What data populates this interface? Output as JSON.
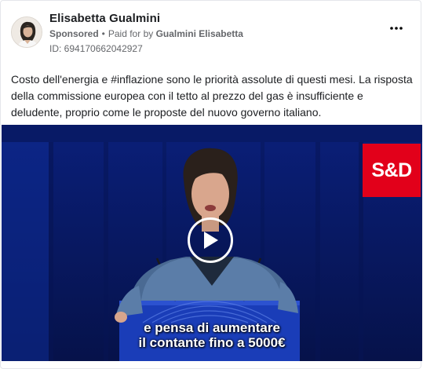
{
  "post": {
    "author": "Elisabetta Gualmini",
    "sponsored": "Sponsored",
    "separator": "•",
    "paid_for_prefix": "Paid for by",
    "payer": "Gualmini Elisabetta",
    "ad_id": "ID: 694170662042927",
    "more_icon": "more-horizontal-icon",
    "text": "Costo dell'energia e #inflazione sono le priorità assolute di questi mesi. La risposta della commissione europea con il tetto al prezzo del gas è insufficiente e deludente, proprio come le proposte del nuovo governo italiano."
  },
  "video": {
    "logo_text": "S&D",
    "caption_line1": "e pensa di aumentare",
    "caption_line2": "il contante fino a 5000€",
    "play_icon": "play-icon",
    "colors": {
      "logo_red": "#e2001a",
      "backdrop_blue": "#0b1c66",
      "eu_blue": "#1a3db8"
    }
  }
}
